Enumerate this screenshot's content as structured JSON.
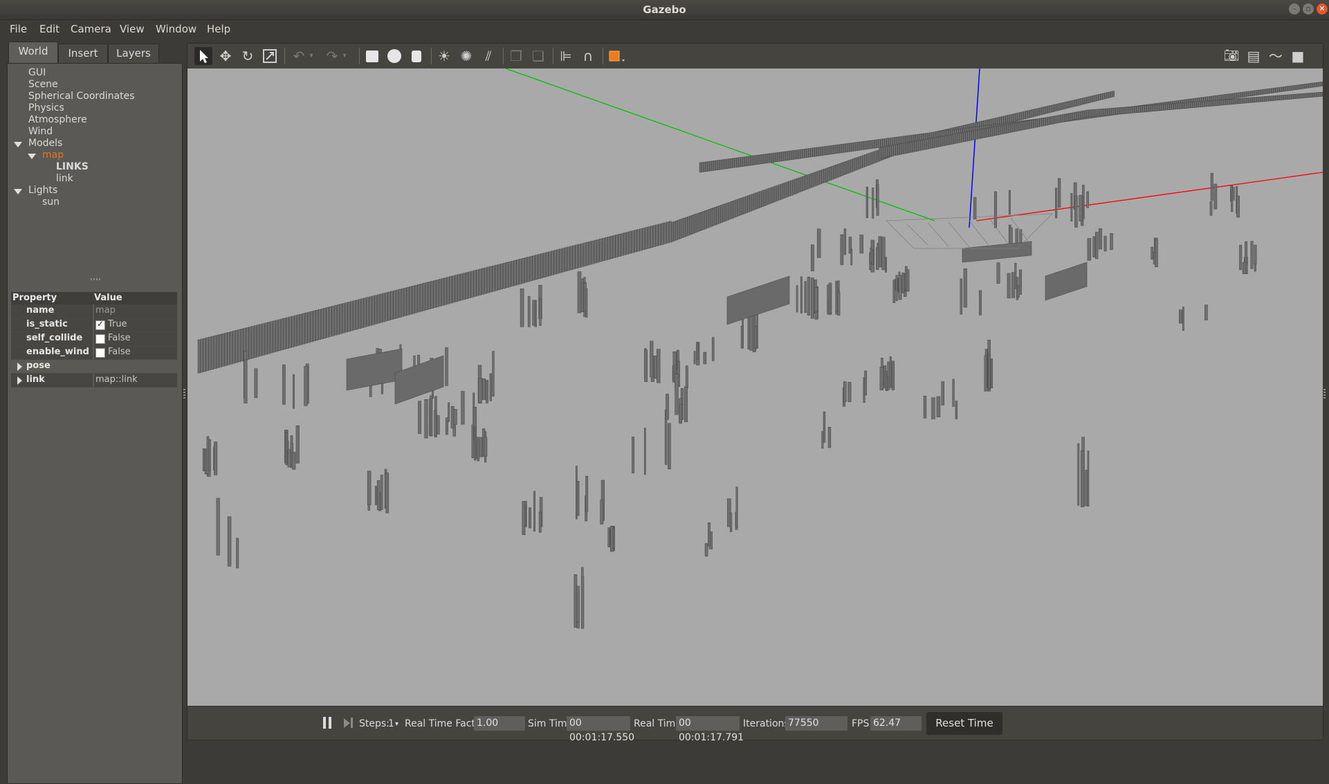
{
  "window": {
    "title": "Gazebo"
  },
  "menu": [
    "File",
    "Edit",
    "Camera",
    "View",
    "Window",
    "Help"
  ],
  "left_tabs": [
    "World",
    "Insert",
    "Layers"
  ],
  "tree": {
    "gui": "GUI",
    "scene": "Scene",
    "spherical": "Spherical Coordinates",
    "physics": "Physics",
    "atmosphere": "Atmosphere",
    "wind": "Wind",
    "models": "Models",
    "map": "map",
    "links": "LINKS",
    "link": "link",
    "lights": "Lights",
    "sun": "sun"
  },
  "properties": {
    "header_property": "Property",
    "header_value": "Value",
    "name_key": "name",
    "name_val": "map",
    "is_static_key": "is_static",
    "is_static_val": "True",
    "self_collide_key": "self_collide",
    "self_collide_val": "False",
    "enable_wind_key": "enable_wind",
    "enable_wind_val": "False",
    "pose_key": "pose",
    "link_key": "link",
    "link_val": "map::link"
  },
  "toolbar": {
    "icons": [
      "select-mode-icon",
      "translate-icon",
      "rotate-icon",
      "scale-icon",
      "undo-icon",
      "redo-icon",
      "box-icon",
      "sphere-icon",
      "cylinder-icon",
      "point-light-icon",
      "spot-light-icon",
      "directional-light-icon",
      "copy-icon",
      "paste-icon",
      "align-icon",
      "snap-icon",
      "view-angle-icon",
      "screenshot-icon",
      "log-icon",
      "plot-icon",
      "video-icon"
    ]
  },
  "bottom": {
    "steps_label": "Steps:",
    "steps_val": "1",
    "rtf_label": "Real Time Factor:",
    "rtf_val": "1.00",
    "sim_label": "Sim Time:",
    "sim_val": "00 00:01:17.550",
    "real_label": "Real Time:",
    "real_val": "00 00:01:17.791",
    "iter_label": "Iterations:",
    "iter_val": "77550",
    "fps_label": "FPS:",
    "fps_val": "62.47",
    "reset_label": "Reset Time"
  },
  "colors": {
    "selected_tree": "#e8761a",
    "viewport_bg": "#a9a9a9",
    "axis_x": "#ff0000",
    "axis_y": "#00c000",
    "axis_z": "#0000ff"
  }
}
